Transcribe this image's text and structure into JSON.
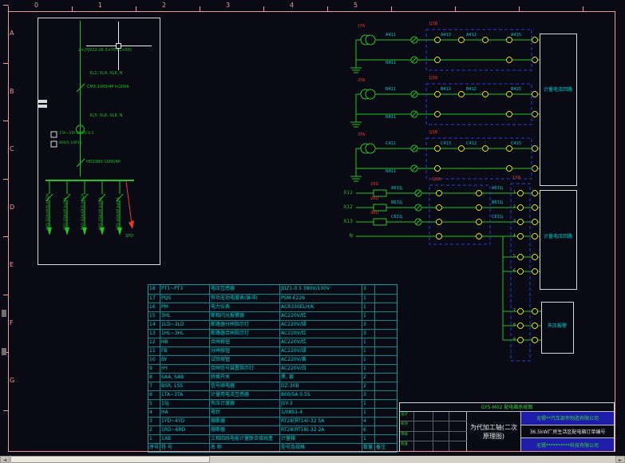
{
  "colors": {
    "frame_pink": "#f09c9c",
    "wire_green": "#21c421",
    "label_cyan": "#00d2d2",
    "label_red": "#e23b2e",
    "terminal_yellow": "#d8d800",
    "dashed_blue": "#2b3be0",
    "border_white": "#d9d9d9",
    "highlight_blue": "#1d1daa",
    "background": "#0a0a14"
  },
  "icons": {
    "scroll_left": "◄",
    "scroll_right": "►"
  },
  "ruler": {
    "columns": [
      "0",
      "1",
      "2",
      "3",
      "4",
      "5"
    ],
    "rows": [
      "A",
      "B",
      "C",
      "D",
      "E",
      "F",
      "G"
    ]
  },
  "sld": {
    "cable": "2×(YJV22-26 3×70+1×50)",
    "feeder_group1": "XL1: XL4, XL6, N",
    "main_breaker": "CM3-1000/4P In100A",
    "feeder_group2": "XL5: XL6, XL8, N",
    "ct_spec1": "1TA~3TA 800/5 0.5",
    "ct_spec2": "800/5 10P10",
    "isolator": "HD13BX-1000/4P",
    "branches": [
      "C65-32A/4P/D In32A",
      "C65-25A/4P In25A",
      "C65-32A/4P/D In32A",
      "C65-25A/4P In25A",
      "C65-40A/4P In40A"
    ],
    "spd_label": "SPD"
  },
  "metering": {
    "current_box_label": "计量电流回路",
    "voltage_box_label": "计量电压回路",
    "alarm_box_label": "失压报警",
    "current_rows": [
      {
        "ct": "1TA",
        "jsb": "1JSB",
        "w1": "A411",
        "w2": "A413",
        "w3": "A412",
        "w4": "A415",
        "n": "N411"
      },
      {
        "ct": "2TA",
        "jsb": "1JSB",
        "w1": "B411",
        "w2": "B413",
        "w3": "B412",
        "w4": "B415",
        "n": "N411"
      },
      {
        "ct": "3TA",
        "jsb": "1JSB",
        "w1": "C411",
        "w2": "C413",
        "w3": "C412",
        "w4": "C415",
        "n": "N411"
      }
    ],
    "voltage_rows": [
      {
        "bus": "X11",
        "fuse": "1RD",
        "wire": "A631j"
      },
      {
        "bus": "X12",
        "fuse": "2RD",
        "wire": "B631j"
      },
      {
        "bus": "X13",
        "fuse": "3RD",
        "wire": "C631j"
      },
      {
        "bus": "N",
        "fuse": "",
        "wire": ""
      }
    ],
    "voltage_jsb": "1JSB",
    "strip_label": "1XB",
    "strip_terminals": [
      "1",
      "2",
      "3",
      "4",
      "5",
      "6",
      "7",
      "8",
      "9"
    ]
  },
  "bom": {
    "headers": [
      "序号",
      "符 号",
      "名 称",
      "型号及规格",
      "数量",
      "备注"
    ],
    "rows": [
      [
        "18",
        "PT1~PT3",
        "电压互感器",
        "JDZ1-0.5 380V/100V",
        "3",
        ""
      ],
      [
        "17",
        "PQS",
        "有功无功电度表(脉冲)",
        "PSM-E226",
        "1",
        ""
      ],
      [
        "16",
        "PM",
        "电力仪表",
        "ACR330ELH/K",
        "1",
        ""
      ],
      [
        "15",
        "3HL",
        "断相闪光报警器",
        "AC220V/红",
        "1",
        ""
      ],
      [
        "14",
        "1LD~3LD",
        "断路器分闸指示灯",
        "AC220V/绿",
        "3",
        ""
      ],
      [
        "13",
        "1HL~3HL",
        "断路器合闸指示灯",
        "AC220V/红",
        "3",
        ""
      ],
      [
        "12",
        "HB",
        "合闸按钮",
        "AC220V/红",
        "1",
        ""
      ],
      [
        "11",
        "FB",
        "分闸按钮",
        "AC220V/绿",
        "1",
        ""
      ],
      [
        "10",
        "BY",
        "试验按钮",
        "AC220V/黄",
        "1",
        ""
      ],
      [
        "9",
        "HY",
        "合闸信号装置指示灯",
        "AC220V/白",
        "1",
        ""
      ],
      [
        "8",
        "SAA, SAB",
        "转换开关",
        "黑, 银",
        "2",
        ""
      ],
      [
        "7",
        "BSR, 1SS",
        "信号继电器",
        "DZ-30B",
        "2",
        ""
      ],
      [
        "6",
        "1TA~3TA",
        "计量用电流互感器",
        "800/5A 0.5S",
        "3",
        ""
      ],
      [
        "5",
        "1SJ",
        "失压计度器",
        "JSY-3",
        "1",
        ""
      ],
      [
        "4",
        "HA",
        "电铃",
        "1/0851-4",
        "1",
        ""
      ],
      [
        "3",
        "1YD~4YD",
        "熔断器",
        "RT28(RT14)-32 5A",
        "4",
        ""
      ],
      [
        "2",
        "1RD~6RD",
        "熔断器",
        "RT28(RT18)-32 2A",
        "6",
        ""
      ],
      [
        "1",
        "1XB",
        "三相四线电能计量联合接线盒",
        "计量箱",
        "1",
        ""
      ]
    ]
  },
  "titleblock": {
    "doc_no": "GY5-M02 配电箱系统图",
    "drawing_title": "为代加工轴(二次原理图)",
    "company_top": "无锡**汽车部件制造有限公司",
    "project": "36.5kW厂房生活区配电箱订单编号",
    "company_bottom": "无锡**********科技有限公司",
    "sig_rows": [
      "设计",
      "校对",
      "审核",
      "批准"
    ]
  }
}
